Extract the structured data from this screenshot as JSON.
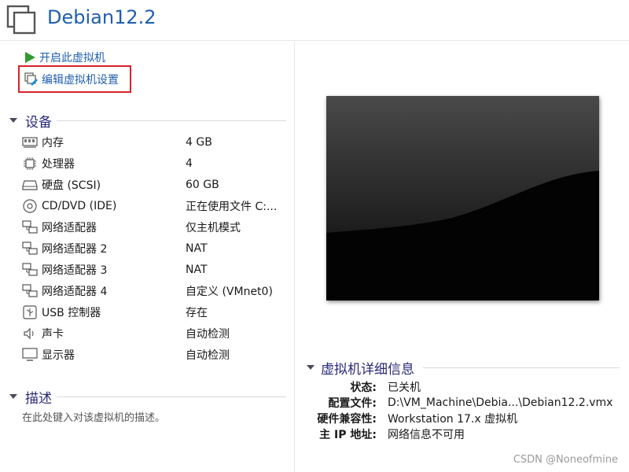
{
  "window": {
    "title": "Debian12.2"
  },
  "actions": {
    "start": "开启此虚拟机",
    "edit": "编辑虚拟机设置"
  },
  "devices": {
    "header": "设备",
    "items": [
      {
        "icon": "memory-icon",
        "name": "内存",
        "value": "4 GB"
      },
      {
        "icon": "processor-icon",
        "name": "处理器",
        "value": "4"
      },
      {
        "icon": "hard-disk-icon",
        "name": "硬盘 (SCSI)",
        "value": "60 GB"
      },
      {
        "icon": "cd-dvd-icon",
        "name": "CD/DVD (IDE)",
        "value": "正在使用文件 C:..."
      },
      {
        "icon": "network-adapter-icon",
        "name": "网络适配器",
        "value": "仅主机模式"
      },
      {
        "icon": "network-adapter-icon",
        "name": "网络适配器 2",
        "value": "NAT"
      },
      {
        "icon": "network-adapter-icon",
        "name": "网络适配器 3",
        "value": "NAT"
      },
      {
        "icon": "network-adapter-icon",
        "name": "网络适配器 4",
        "value": "自定义 (VMnet0)"
      },
      {
        "icon": "usb-icon",
        "name": "USB 控制器",
        "value": "存在"
      },
      {
        "icon": "sound-card-icon",
        "name": "声卡",
        "value": "自动检测"
      },
      {
        "icon": "display-icon",
        "name": "显示器",
        "value": "自动检测"
      }
    ]
  },
  "description": {
    "header": "描述",
    "placeholder": "在此处键入对该虚拟机的描述。"
  },
  "details": {
    "header": "虚拟机详细信息",
    "rows": [
      {
        "key": "状态:",
        "value": "已关机"
      },
      {
        "key": "配置文件:",
        "value": "D:\\VM_Machine\\Debia...\\Debian12.2.vmx"
      },
      {
        "key": "硬件兼容性:",
        "value": "Workstation 17.x 虚拟机"
      },
      {
        "key": "主 IP 地址:",
        "value": "网络信息不可用"
      }
    ]
  },
  "watermark": "CSDN @Noneofmine",
  "colors": {
    "link": "#1f5fae",
    "section": "#2a2a7a",
    "highlight": "#d6232a",
    "play": "#2e9a2e"
  }
}
